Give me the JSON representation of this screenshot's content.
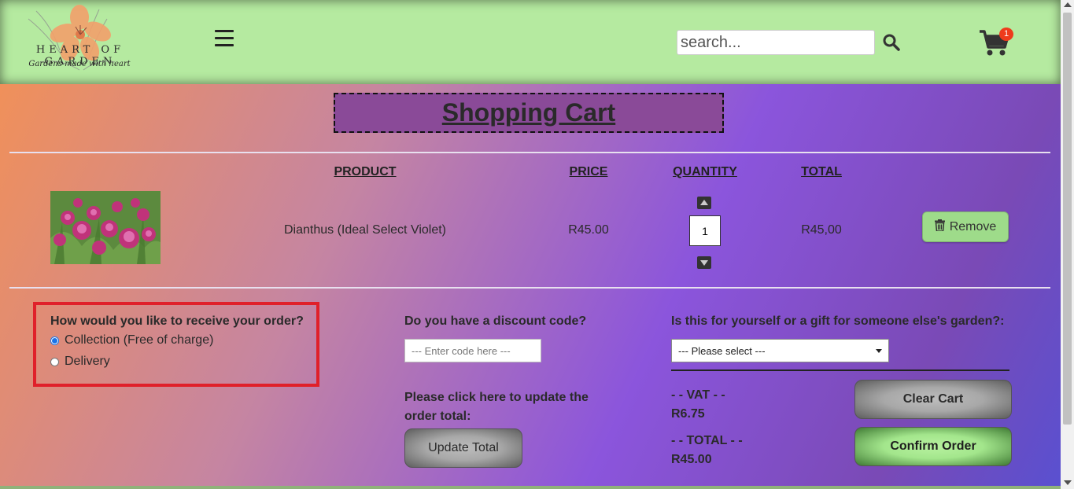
{
  "header": {
    "logo_text": "HEART OF GARDEN",
    "logo_tagline": "Gardens made with heart",
    "search_placeholder": "search...",
    "cart_count": "1"
  },
  "page": {
    "title": "Shopping Cart"
  },
  "cart": {
    "columns": [
      "PRODUCT",
      "PRICE",
      "QUANTITY",
      "TOTAL"
    ],
    "items": [
      {
        "product": "Dianthus (Ideal Select Violet)",
        "price": "R45.00",
        "quantity": "1",
        "total": "R45,00",
        "remove_label": "Remove"
      }
    ]
  },
  "delivery": {
    "question": "How would you like to receive your order?",
    "options": [
      "Collection (Free of charge)",
      "Delivery"
    ],
    "selected": "Collection (Free of charge)"
  },
  "discount": {
    "question": "Do you have a discount code?",
    "placeholder": "--- Enter code here ---",
    "update_prompt": "Please click here to update the order total:",
    "update_label": "Update Total"
  },
  "gift": {
    "question": "Is this for yourself or a gift for someone else's garden?:",
    "selected": "--- Please select ---"
  },
  "summary": {
    "vat_label": "- - VAT - -",
    "vat_value": "R6.75",
    "total_label": "- - TOTAL - -",
    "total_value": "R45.00",
    "clear_label": "Clear Cart",
    "confirm_label": "Confirm Order"
  },
  "colors": {
    "header_bg": "#b5eaa0",
    "title_box": "#8a4a98",
    "highlight_border": "#e0202a",
    "badge": "#ee3b1c",
    "confirm_green": "#a3e68c"
  }
}
